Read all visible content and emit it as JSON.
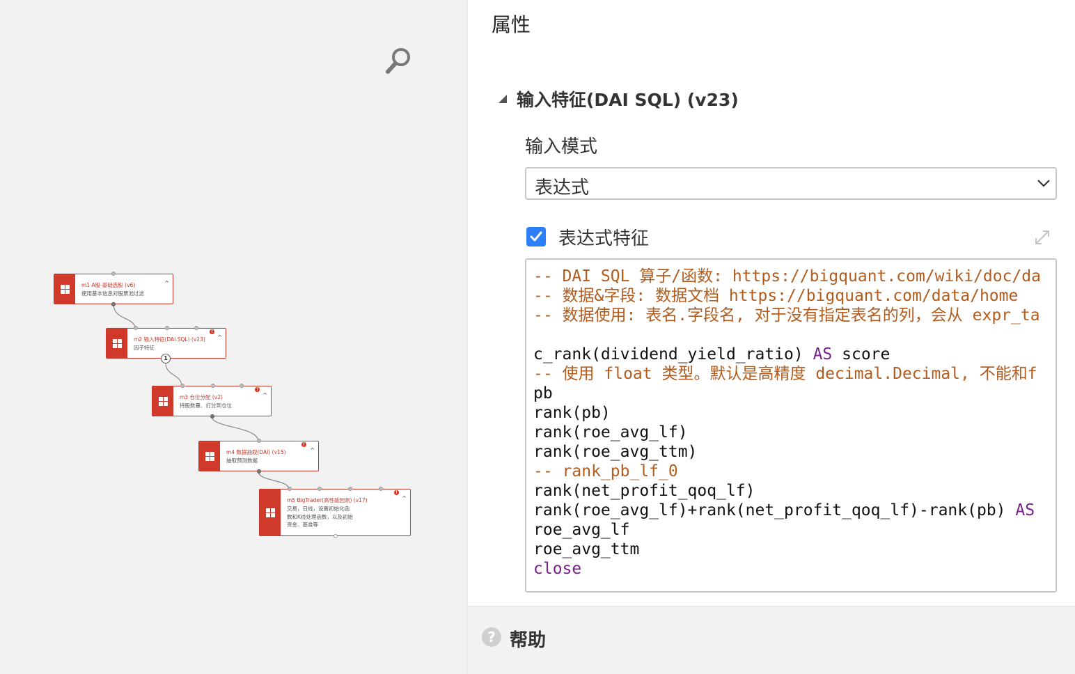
{
  "canvas": {
    "nodes": [
      {
        "title": "m1 A股-基础选股 (v6)",
        "desc": "使用基本信息对股票池过滤"
      },
      {
        "title": "m2 输入特征(DAI SQL) (v23)",
        "desc": "因子特征",
        "port_badge": "1"
      },
      {
        "title": "m3 仓位分配 (v2)",
        "desc": "持股数量、打分到仓位"
      },
      {
        "title": "m4 数据抽取(DAI) (v15)",
        "desc": "抽取预测数据"
      },
      {
        "title": "m5 BigTrader(高性能回测) (v17)",
        "desc": "交易，日线，设置初始化函数和K线处理函数，以及初始资金、基准等"
      }
    ],
    "collapse_glyph": "^",
    "warn_glyph": "!"
  },
  "panel": {
    "title": "属性",
    "section_title": "输入特征(DAI SQL) (v23)",
    "mode_label": "输入模式",
    "mode_value": "表达式",
    "expr_label": "表达式特征",
    "expr_checked": true,
    "code_lines": [
      {
        "parts": [
          {
            "t": "-- DAI SQL 算子/函数: https://bigquant.com/wiki/doc/da",
            "c": "c"
          }
        ]
      },
      {
        "parts": [
          {
            "t": "-- 数据&字段: 数据文档 https://bigquant.com/data/home",
            "c": "c"
          }
        ]
      },
      {
        "parts": [
          {
            "t": "-- 数据使用: 表名.字段名, 对于没有指定表名的列，会从 expr_ta",
            "c": "c"
          }
        ]
      },
      {
        "parts": [
          {
            "t": "",
            "c": "n"
          }
        ]
      },
      {
        "parts": [
          {
            "t": "c_rank(dividend_yield_ratio) ",
            "c": "n"
          },
          {
            "t": "AS",
            "c": "k"
          },
          {
            "t": " score",
            "c": "n"
          }
        ]
      },
      {
        "parts": [
          {
            "t": "-- 使用 float 类型。默认是高精度 decimal.Decimal, 不能和f",
            "c": "c"
          }
        ]
      },
      {
        "parts": [
          {
            "t": "pb",
            "c": "n"
          }
        ]
      },
      {
        "parts": [
          {
            "t": "rank(pb)",
            "c": "n"
          }
        ]
      },
      {
        "parts": [
          {
            "t": "rank(roe_avg_lf)",
            "c": "n"
          }
        ]
      },
      {
        "parts": [
          {
            "t": "rank(roe_avg_ttm)",
            "c": "n"
          }
        ]
      },
      {
        "parts": [
          {
            "t": "-- rank_pb_lf_0",
            "c": "c"
          }
        ]
      },
      {
        "parts": [
          {
            "t": "rank(net_profit_qoq_lf)",
            "c": "n"
          }
        ]
      },
      {
        "parts": [
          {
            "t": "rank(roe_avg_lf)+rank(net_profit_qoq_lf)-rank(pb) ",
            "c": "n"
          },
          {
            "t": "AS",
            "c": "k"
          }
        ]
      },
      {
        "parts": [
          {
            "t": "roe_avg_lf",
            "c": "n"
          }
        ]
      },
      {
        "parts": [
          {
            "t": "roe_avg_ttm",
            "c": "n"
          }
        ]
      },
      {
        "parts": [
          {
            "t": "close",
            "c": "k"
          }
        ]
      }
    ]
  },
  "help": {
    "icon_glyph": "?",
    "label": "帮助"
  },
  "colors": {
    "node_red": "#cf3a2b",
    "checkbox_blue": "#2d7ff9",
    "comment": "#b35c1e",
    "keyword": "#7a1f8c"
  }
}
